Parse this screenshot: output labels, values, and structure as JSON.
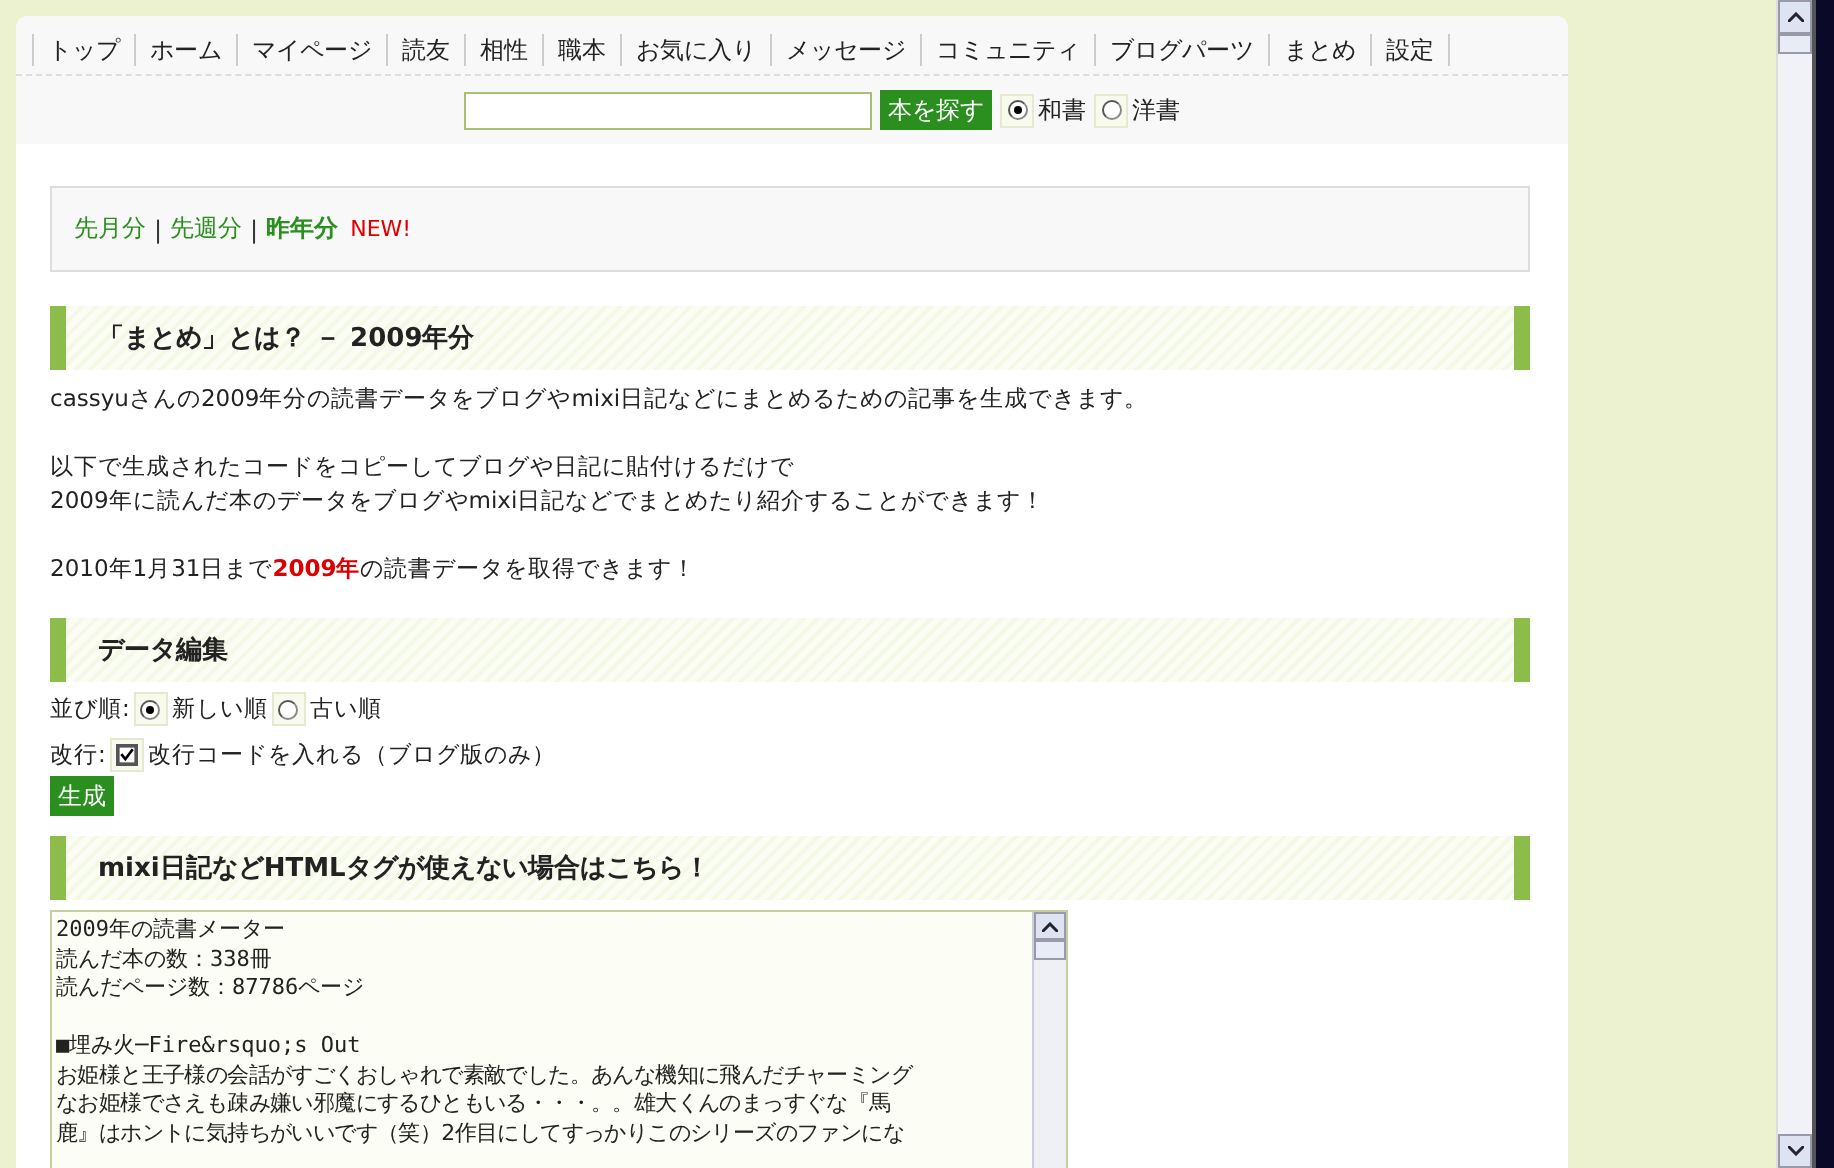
{
  "nav": {
    "items": [
      {
        "label": "トップ"
      },
      {
        "label": "ホーム"
      },
      {
        "label": "マイページ"
      },
      {
        "label": "読友"
      },
      {
        "label": "相性"
      },
      {
        "label": "職本"
      },
      {
        "label": "お気に入り"
      },
      {
        "label": "メッセージ"
      },
      {
        "label": "コミュニティ"
      },
      {
        "label": "ブログパーツ"
      },
      {
        "label": "まとめ"
      },
      {
        "label": "設定"
      }
    ]
  },
  "search": {
    "button": "本を探す",
    "options": [
      {
        "label": "和書",
        "selected": true
      },
      {
        "label": "洋書",
        "selected": false
      }
    ]
  },
  "period_separator": "|",
  "period_tabs": [
    {
      "label": "先月分",
      "selected": false
    },
    {
      "label": "先週分",
      "selected": false
    },
    {
      "label": "昨年分",
      "selected": true
    }
  ],
  "new_badge": "NEW!",
  "about": {
    "heading": "「まとめ」とは？ － 2009年分",
    "paragraphs": [
      "cassyuさんの2009年分の読書データをブログやmixi日記などにまとめるための記事を生成できます。",
      "以下で生成されたコードをコピーしてブログや日記に貼付けるだけで\n2009年に読んだ本のデータをブログやmixi日記などでまとめたり紹介することができます！",
      "2010年1月31日まで**2009年**の読書データを取得できます！"
    ]
  },
  "edit": {
    "heading": "データ編集",
    "sort_label": "並び順:",
    "sort_options": [
      {
        "label": "新しい順",
        "selected": true
      },
      {
        "label": "古い順",
        "selected": false
      }
    ],
    "newline_label": "改行:",
    "newline_option": {
      "label": "改行コードを入れる（ブログ版のみ）",
      "checked": true
    },
    "generate_button": "生成"
  },
  "plain": {
    "heading": "mixi日記などHTMLタグが使えない場合はこちら！",
    "stats": [
      "2009年の読書メーター",
      "読んだ本の数：338冊",
      "読んだページ数：87786ページ"
    ],
    "entry_title": "■埋み火─Fire&rsquo;s Out",
    "review_lines": [
      "お姫様と王子様の会話がすごくおしゃれで素敵でした。あんな機知に飛んだチャーミング",
      "なお姫様でさえも疎み嫌い邪魔にするひともいる・・・。。雄大くんのまっすぐな『馬",
      "鹿』はホントに気持ちがいいです（笑）2作目にしてすっかりこのシリーズのファンにな"
    ]
  }
}
